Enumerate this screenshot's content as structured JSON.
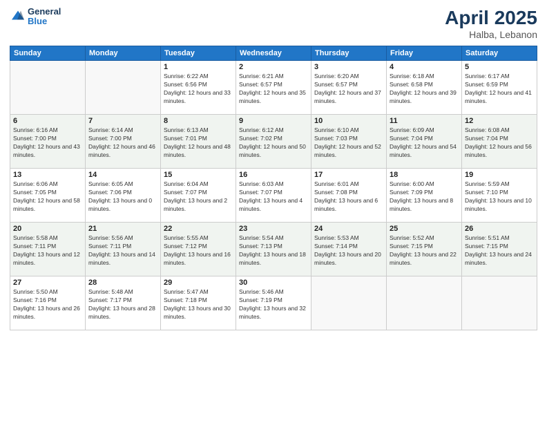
{
  "header": {
    "logo_general": "General",
    "logo_blue": "Blue",
    "month": "April 2025",
    "location": "Halba, Lebanon"
  },
  "weekdays": [
    "Sunday",
    "Monday",
    "Tuesday",
    "Wednesday",
    "Thursday",
    "Friday",
    "Saturday"
  ],
  "days": [
    {
      "date": "",
      "empty": true
    },
    {
      "date": "",
      "empty": true
    },
    {
      "date": "1",
      "sunrise": "6:22 AM",
      "sunset": "6:56 PM",
      "daylight": "12 hours and 33 minutes."
    },
    {
      "date": "2",
      "sunrise": "6:21 AM",
      "sunset": "6:57 PM",
      "daylight": "12 hours and 35 minutes."
    },
    {
      "date": "3",
      "sunrise": "6:20 AM",
      "sunset": "6:57 PM",
      "daylight": "12 hours and 37 minutes."
    },
    {
      "date": "4",
      "sunrise": "6:18 AM",
      "sunset": "6:58 PM",
      "daylight": "12 hours and 39 minutes."
    },
    {
      "date": "5",
      "sunrise": "6:17 AM",
      "sunset": "6:59 PM",
      "daylight": "12 hours and 41 minutes."
    },
    {
      "date": "6",
      "sunrise": "6:16 AM",
      "sunset": "7:00 PM",
      "daylight": "12 hours and 43 minutes."
    },
    {
      "date": "7",
      "sunrise": "6:14 AM",
      "sunset": "7:00 PM",
      "daylight": "12 hours and 46 minutes."
    },
    {
      "date": "8",
      "sunrise": "6:13 AM",
      "sunset": "7:01 PM",
      "daylight": "12 hours and 48 minutes."
    },
    {
      "date": "9",
      "sunrise": "6:12 AM",
      "sunset": "7:02 PM",
      "daylight": "12 hours and 50 minutes."
    },
    {
      "date": "10",
      "sunrise": "6:10 AM",
      "sunset": "7:03 PM",
      "daylight": "12 hours and 52 minutes."
    },
    {
      "date": "11",
      "sunrise": "6:09 AM",
      "sunset": "7:04 PM",
      "daylight": "12 hours and 54 minutes."
    },
    {
      "date": "12",
      "sunrise": "6:08 AM",
      "sunset": "7:04 PM",
      "daylight": "12 hours and 56 minutes."
    },
    {
      "date": "13",
      "sunrise": "6:06 AM",
      "sunset": "7:05 PM",
      "daylight": "12 hours and 58 minutes."
    },
    {
      "date": "14",
      "sunrise": "6:05 AM",
      "sunset": "7:06 PM",
      "daylight": "13 hours and 0 minutes."
    },
    {
      "date": "15",
      "sunrise": "6:04 AM",
      "sunset": "7:07 PM",
      "daylight": "13 hours and 2 minutes."
    },
    {
      "date": "16",
      "sunrise": "6:03 AM",
      "sunset": "7:07 PM",
      "daylight": "13 hours and 4 minutes."
    },
    {
      "date": "17",
      "sunrise": "6:01 AM",
      "sunset": "7:08 PM",
      "daylight": "13 hours and 6 minutes."
    },
    {
      "date": "18",
      "sunrise": "6:00 AM",
      "sunset": "7:09 PM",
      "daylight": "13 hours and 8 minutes."
    },
    {
      "date": "19",
      "sunrise": "5:59 AM",
      "sunset": "7:10 PM",
      "daylight": "13 hours and 10 minutes."
    },
    {
      "date": "20",
      "sunrise": "5:58 AM",
      "sunset": "7:11 PM",
      "daylight": "13 hours and 12 minutes."
    },
    {
      "date": "21",
      "sunrise": "5:56 AM",
      "sunset": "7:11 PM",
      "daylight": "13 hours and 14 minutes."
    },
    {
      "date": "22",
      "sunrise": "5:55 AM",
      "sunset": "7:12 PM",
      "daylight": "13 hours and 16 minutes."
    },
    {
      "date": "23",
      "sunrise": "5:54 AM",
      "sunset": "7:13 PM",
      "daylight": "13 hours and 18 minutes."
    },
    {
      "date": "24",
      "sunrise": "5:53 AM",
      "sunset": "7:14 PM",
      "daylight": "13 hours and 20 minutes."
    },
    {
      "date": "25",
      "sunrise": "5:52 AM",
      "sunset": "7:15 PM",
      "daylight": "13 hours and 22 minutes."
    },
    {
      "date": "26",
      "sunrise": "5:51 AM",
      "sunset": "7:15 PM",
      "daylight": "13 hours and 24 minutes."
    },
    {
      "date": "27",
      "sunrise": "5:50 AM",
      "sunset": "7:16 PM",
      "daylight": "13 hours and 26 minutes."
    },
    {
      "date": "28",
      "sunrise": "5:48 AM",
      "sunset": "7:17 PM",
      "daylight": "13 hours and 28 minutes."
    },
    {
      "date": "29",
      "sunrise": "5:47 AM",
      "sunset": "7:18 PM",
      "daylight": "13 hours and 30 minutes."
    },
    {
      "date": "30",
      "sunrise": "5:46 AM",
      "sunset": "7:19 PM",
      "daylight": "13 hours and 32 minutes."
    },
    {
      "date": "",
      "empty": true
    },
    {
      "date": "",
      "empty": true
    },
    {
      "date": "",
      "empty": true
    }
  ]
}
